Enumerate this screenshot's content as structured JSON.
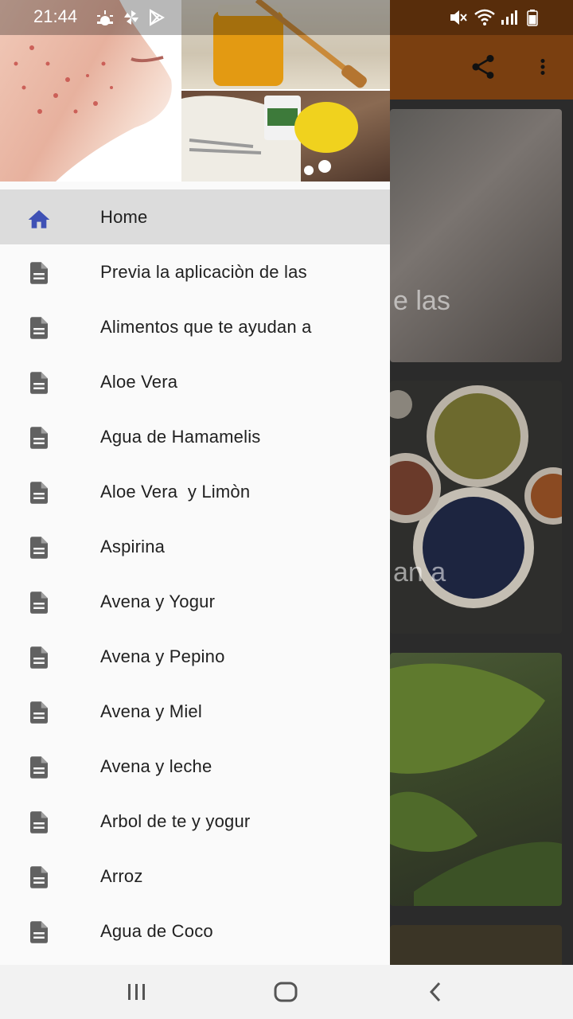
{
  "status_bar": {
    "time": "21:44"
  },
  "toolbar": {
    "share_icon": "share-icon",
    "more_icon": "more-vert-icon",
    "color": "#7a3f10"
  },
  "background_cards": [
    {
      "title_fragment": "e las"
    },
    {
      "title_fragment": "an a"
    },
    {
      "title_fragment": ""
    },
    {
      "title_fragment": ""
    }
  ],
  "drawer": {
    "menu": [
      {
        "label": "Home",
        "icon": "home-icon",
        "active": true
      },
      {
        "label": "Previa la aplicaciòn de las",
        "icon": "document-icon"
      },
      {
        "label": "Alimentos que te ayudan a",
        "icon": "document-icon"
      },
      {
        "label": "Aloe Vera",
        "icon": "document-icon"
      },
      {
        "label": "Agua de Hamamelis",
        "icon": "document-icon"
      },
      {
        "label": "Aloe Vera  y Limòn",
        "icon": "document-icon"
      },
      {
        "label": "Aspirina",
        "icon": "document-icon"
      },
      {
        "label": "Avena y Yogur",
        "icon": "document-icon"
      },
      {
        "label": "Avena y Pepino",
        "icon": "document-icon"
      },
      {
        "label": "Avena y Miel",
        "icon": "document-icon"
      },
      {
        "label": "Avena y leche",
        "icon": "document-icon"
      },
      {
        "label": "Arbol de te y yogur",
        "icon": "document-icon"
      },
      {
        "label": "Arroz",
        "icon": "document-icon"
      },
      {
        "label": "Agua de Coco",
        "icon": "document-icon"
      }
    ],
    "active_color": "#3f51b5",
    "icon_color": "#616161"
  }
}
